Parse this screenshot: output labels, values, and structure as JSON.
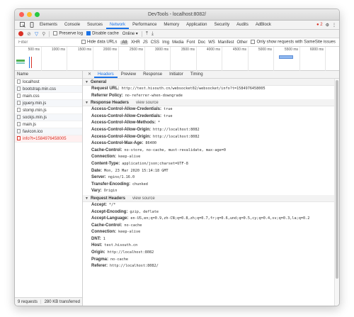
{
  "window": {
    "title": "DevTools - localhost:8082/"
  },
  "tabs": [
    {
      "label": "Elements"
    },
    {
      "label": "Console"
    },
    {
      "label": "Sources"
    },
    {
      "label": "Network",
      "active": true
    },
    {
      "label": "Performance"
    },
    {
      "label": "Memory"
    },
    {
      "label": "Application"
    },
    {
      "label": "Security"
    },
    {
      "label": "Audits"
    },
    {
      "label": "AdBlock"
    }
  ],
  "error_count": "2",
  "toolbar": {
    "preserve_log": "Preserve log",
    "disable_cache": "Disable cache",
    "throttle": "Online"
  },
  "filterbar": {
    "placeholder": "Filter",
    "hide_data_urls": "Hide data URLs",
    "types": [
      "All",
      "XHR",
      "JS",
      "CSS",
      "Img",
      "Media",
      "Font",
      "Doc",
      "WS",
      "Manifest",
      "Other"
    ],
    "samesite": "Only show requests with SameSite issues"
  },
  "timeline": {
    "ticks": [
      "500 ms",
      "1000 ms",
      "1500 ms",
      "2000 ms",
      "2500 ms",
      "3000 ms",
      "3500 ms",
      "4000 ms",
      "4500 ms",
      "5000 ms",
      "5500 ms",
      "6000 ms"
    ]
  },
  "requests": {
    "header": "Name",
    "items": [
      {
        "name": "localhost"
      },
      {
        "name": "bootstrap.min.css"
      },
      {
        "name": "main.css"
      },
      {
        "name": "jquery.min.js"
      },
      {
        "name": "stomp.min.js"
      },
      {
        "name": "sockjs.min.js"
      },
      {
        "name": "main.js"
      },
      {
        "name": "favicon.ico"
      },
      {
        "name": "info?t=1584976458005",
        "error": true
      }
    ]
  },
  "status": {
    "requests": "9 requests",
    "transferred": "280 KB transferred"
  },
  "detail_tabs": [
    "Headers",
    "Preview",
    "Response",
    "Initiator",
    "Timing"
  ],
  "general": {
    "title": "General",
    "rows": [
      {
        "key": "Request URL:",
        "value": "http://test.hisouth.cn/websocket02/websocket/info?t=1584976458005"
      },
      {
        "key": "Referrer Policy:",
        "value": "no-referrer-when-downgrade"
      }
    ]
  },
  "response_headers": {
    "title": "Response Headers",
    "view_source": "view source",
    "rows": [
      {
        "key": "Access-Control-Allow-Credentials:",
        "value": "true"
      },
      {
        "key": "Access-Control-Allow-Credentials:",
        "value": "true"
      },
      {
        "key": "Access-Control-Allow-Methods:",
        "value": "*"
      },
      {
        "key": "Access-Control-Allow-Origin:",
        "value": "http://localhost:8082"
      },
      {
        "key": "Access-Control-Allow-Origin:",
        "value": "http://localhost:8082"
      },
      {
        "key": "Access-Control-Max-Age:",
        "value": "86400"
      },
      {
        "key": "Cache-Control:",
        "value": "no-store, no-cache, must-revalidate, max-age=0"
      },
      {
        "key": "Connection:",
        "value": "keep-alive"
      },
      {
        "key": "Content-Type:",
        "value": "application/json;charset=UTF-8"
      },
      {
        "key": "Date:",
        "value": "Mon, 23 Mar 2020 15:14:18 GMT"
      },
      {
        "key": "Server:",
        "value": "nginx/1.16.0"
      },
      {
        "key": "Transfer-Encoding:",
        "value": "chunked"
      },
      {
        "key": "Vary:",
        "value": "Origin"
      }
    ]
  },
  "request_headers": {
    "title": "Request Headers",
    "view_source": "view source",
    "rows": [
      {
        "key": "Accept:",
        "value": "*/*"
      },
      {
        "key": "Accept-Encoding:",
        "value": "gzip, deflate"
      },
      {
        "key": "Accept-Language:",
        "value": "en-US,en;q=0.9,zh-CN;q=0.8,zh;q=0.7,fr;q=0.6,und;q=0.5,cy;q=0.4,sv;q=0.3,la;q=0.2"
      },
      {
        "key": "Cache-Control:",
        "value": "no-cache"
      },
      {
        "key": "Connection:",
        "value": "keep-alive"
      },
      {
        "key": "DNT:",
        "value": "1"
      },
      {
        "key": "Host:",
        "value": "test.hisouth.cn"
      },
      {
        "key": "Origin:",
        "value": "http://localhost:8082"
      },
      {
        "key": "Pragma:",
        "value": "no-cache"
      },
      {
        "key": "Referer:",
        "value": "http://localhost:8082/"
      }
    ]
  },
  "colors": {
    "accent": "#1a73e8",
    "error": "#d93025"
  }
}
